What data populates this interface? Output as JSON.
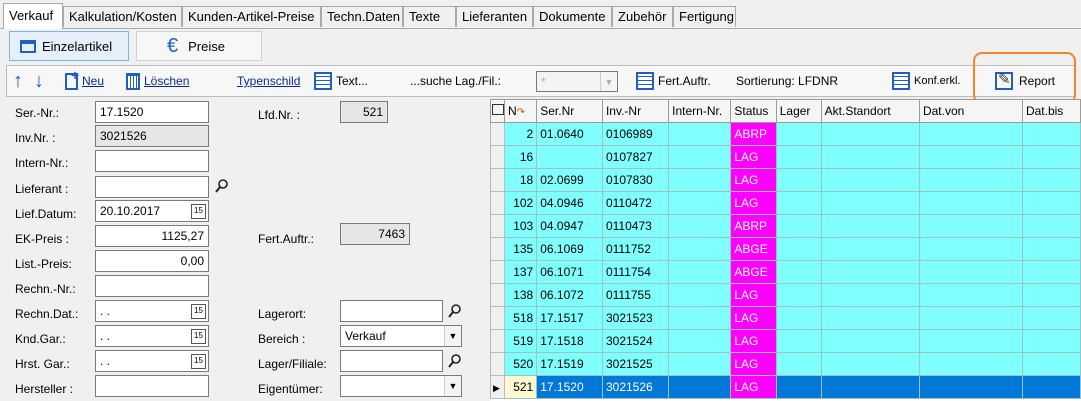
{
  "tabs": [
    "Verkauf",
    "Kalkulation/Kosten",
    "Kunden-Artikel-Preise",
    "Techn.Daten",
    "Texte",
    "Lieferanten",
    "Dokumente",
    "Zubehör",
    "Fertigung"
  ],
  "subtabs": {
    "einzelartikel": "Einzelartikel",
    "preise": "Preise"
  },
  "toolbar": {
    "neu": "Neu",
    "loeschen": "Löschen",
    "typenschild": "Typenschild",
    "text": "Text...",
    "suche": "...suche",
    "lagfil_label": "Lag./Fil.:",
    "lagfil_value": "*",
    "fertauftr": "Fert.Auftr.",
    "sortierung": "Sortierung: LFDNR",
    "konferkl": "Konf.erkl.",
    "report": "Report"
  },
  "form": {
    "sernr_label": "Ser.-Nr.:",
    "sernr_value": "17.1520",
    "invnr_label": "Inv.Nr. :",
    "invnr_value": "3021526",
    "internnr_label": "Intern-Nr.:",
    "internnr_value": "",
    "lieferant_label": "Lieferant :",
    "lieferant_value": "",
    "liefdatum_label": "Lief.Datum:",
    "liefdatum_value": "20.10.2017",
    "ekpreis_label": "EK-Preis :",
    "ekpreis_value": "1125,27",
    "listpreis_label": "List.-Preis:",
    "listpreis_value": "0,00",
    "rechnnr_label": "Rechn.-Nr.:",
    "rechnnr_value": "",
    "rechndat_label": "Rechn.Dat.:",
    "rechndat_value": " .  .",
    "kndgar_label": "Knd.Gar.:",
    "kndgar_value": " .  .",
    "hrstgar_label": "Hrst. Gar.:",
    "hrstgar_value": " .  .",
    "hersteller_label": "Hersteller :",
    "hersteller_value": "",
    "lfdnr_label": "Lfd.Nr. :",
    "lfdnr_value": "521",
    "fertauftr_label": "Fert.Auftr.:",
    "fertauftr_value": "7463",
    "lagerort_label": "Lagerort:",
    "lagerort_value": "",
    "bereich_label": "Bereich :",
    "bereich_value": "Verkauf",
    "lagerfiliale_label": "Lager/Filiale:",
    "lagerfiliale_value": "",
    "eigentuemer_label": "Eigentümer:",
    "eigentuemer_value": ""
  },
  "grid": {
    "columns": [
      "N",
      "Ser.Nr",
      "Inv.-Nr",
      "Intern-Nr.",
      "Status",
      "Lager",
      "Akt.Standort",
      "Dat.von",
      "Dat.bis"
    ],
    "rows": [
      {
        "n": "2",
        "ser": "01.0640",
        "inv": "0106989",
        "status": "ABRP"
      },
      {
        "n": "16",
        "ser": "",
        "inv": "0107827",
        "status": "LAG"
      },
      {
        "n": "18",
        "ser": "02.0699",
        "inv": "0107830",
        "status": "LAG"
      },
      {
        "n": "102",
        "ser": "04.0946",
        "inv": "0110472",
        "status": "LAG"
      },
      {
        "n": "103",
        "ser": "04.0947",
        "inv": "0110473",
        "status": "ABRP"
      },
      {
        "n": "135",
        "ser": "06.1069",
        "inv": "0111752",
        "status": "ABGE"
      },
      {
        "n": "137",
        "ser": "06.1071",
        "inv": "0111754",
        "status": "ABGE"
      },
      {
        "n": "138",
        "ser": "06.1072",
        "inv": "0111755",
        "status": "LAG"
      },
      {
        "n": "518",
        "ser": "17.1517",
        "inv": "3021523",
        "status": "LAG"
      },
      {
        "n": "519",
        "ser": "17.1518",
        "inv": "3021524",
        "status": "LAG"
      },
      {
        "n": "520",
        "ser": "17.1519",
        "inv": "3021525",
        "status": "LAG"
      },
      {
        "n": "521",
        "ser": "17.1520",
        "inv": "3021526",
        "status": "LAG"
      }
    ]
  },
  "colors": {
    "grid_row": "#80ffff",
    "status": "#ff00ff",
    "selected": "#0078d7",
    "highlight": "#f0862c"
  }
}
